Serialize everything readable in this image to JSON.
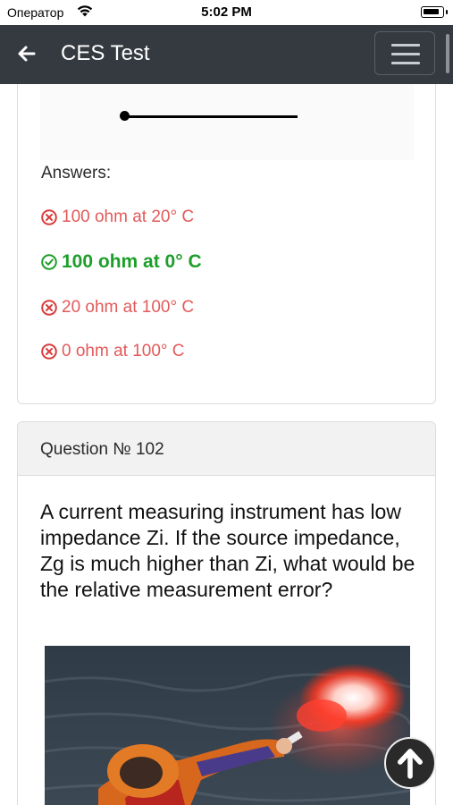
{
  "status_bar": {
    "carrier": "Оператор",
    "time": "5:02 PM",
    "wifi_icon": "wifi-icon",
    "battery_icon": "battery-icon"
  },
  "navbar": {
    "title": "CES Test",
    "back_icon": "arrow-left-icon",
    "menu_icon": "hamburger-menu-icon",
    "background": "#343a40"
  },
  "previous_question": {
    "answers_label": "Answers:",
    "answers": [
      {
        "text": "100 ohm at 20° C",
        "correct": false
      },
      {
        "text": "100 ohm at 0° C",
        "correct": true
      },
      {
        "text": "20 ohm at 100° C",
        "correct": false
      },
      {
        "text": "0 ohm at 100° C",
        "correct": false
      }
    ]
  },
  "current_question": {
    "number_label": "Question № 102",
    "text": "A current measuring instrument has low impedance Zi. If the source impedance, Zg is much higher than Zi, what would be the relative measurement error?",
    "image_icon": "flare-photo"
  },
  "scroll_top_icon": "arrow-up-icon",
  "colors": {
    "wrong": "#e35a5a",
    "correct": "#1e9e2a",
    "header_bg": "#f2f2f2"
  }
}
